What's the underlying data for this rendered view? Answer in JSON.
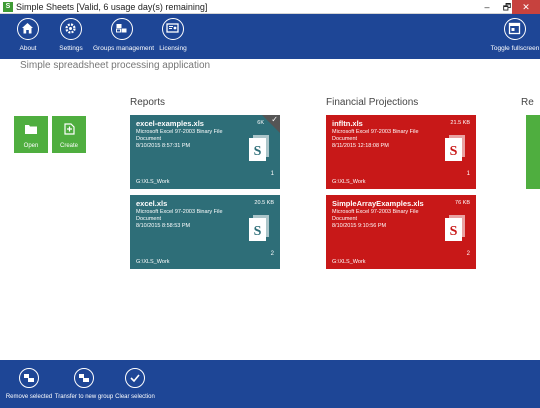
{
  "window": {
    "title": "Simple Sheets [Valid, 6 usage day(s) remaining]",
    "minimize": "–",
    "maximize": "🗗",
    "close": "✕"
  },
  "topbar": {
    "about": "About",
    "settings": "Settings",
    "groups": "Groups management",
    "licensing": "Licensing",
    "fullscreen": "Toggle fullscreen"
  },
  "subtitle": "Simple spreadsheet processing application",
  "actions": {
    "open": "Open",
    "create": "Create"
  },
  "groups": {
    "reports": "Reports",
    "financial": "Financial Projections",
    "third": "Re"
  },
  "tiles": [
    {
      "name": "excel-examples.xls",
      "size": "6K",
      "desc": "Microsoft Excel 97-2003 Binary File Document",
      "date": "8/10/2015 8:57:31 PM",
      "path": "G:\\XLS_Work",
      "num": "1"
    },
    {
      "name": "excel.xls",
      "size": "20.5 KB",
      "desc": "Microsoft Excel 97-2003 Binary File Document",
      "date": "8/10/2015 8:58:53 PM",
      "path": "G:\\XLS_Work",
      "num": "2"
    },
    {
      "name": "infltn.xls",
      "size": "21.5 KB",
      "desc": "Microsoft Excel 97-2003 Binary File Document",
      "date": "8/11/2015 12:18:08 PM",
      "path": "G:\\XLS_Work",
      "num": "1"
    },
    {
      "name": "SimpleArrayExamples.xls",
      "size": "76 KB",
      "desc": "Microsoft Excel 97-2003 Binary File Document",
      "date": "8/10/2015 9:10:56 PM",
      "path": "G:\\XLS_Work",
      "num": "2"
    }
  ],
  "doc_icon_letter": "S",
  "bottombar": {
    "remove": "Remove selected",
    "transfer": "Transfer to new group",
    "clear": "Clear selection"
  },
  "colors": {
    "ribbon": "#1e4696",
    "teal_tile": "#2e6e78",
    "red_tile": "#c81818",
    "green_action": "#4fae3f"
  }
}
